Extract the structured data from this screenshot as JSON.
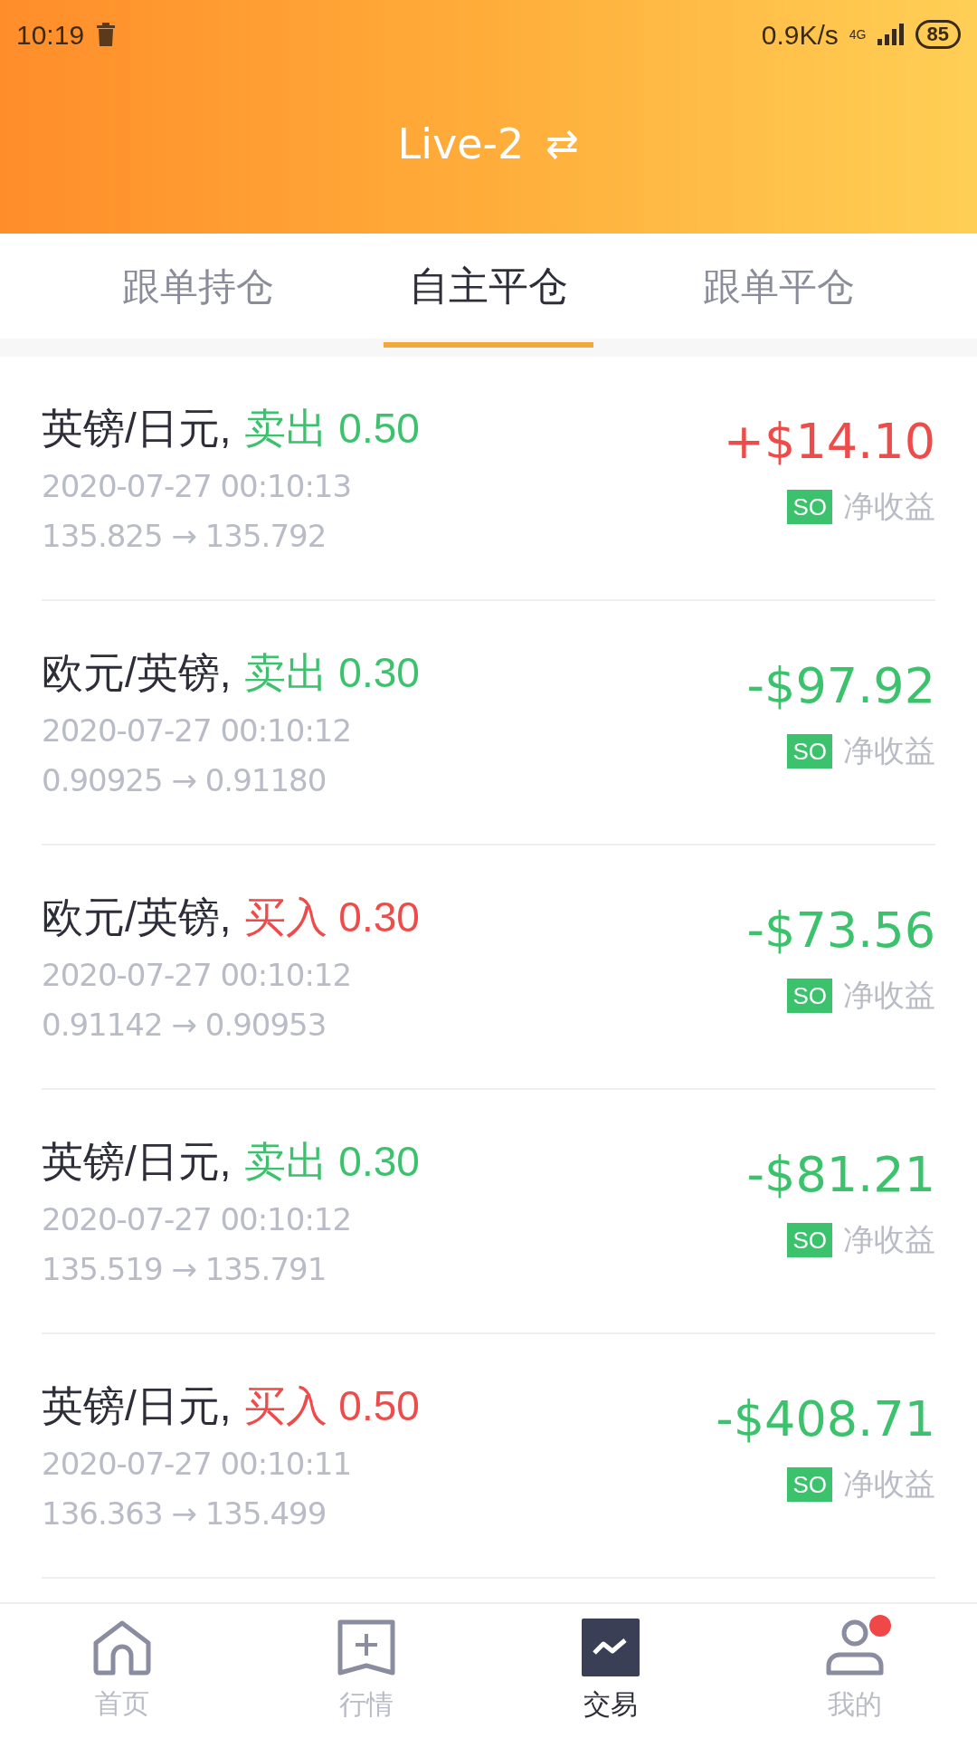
{
  "status_bar": {
    "time": "10:19",
    "speed": "0.9K/s",
    "network": "4G",
    "battery": "85"
  },
  "header": {
    "title": "Live-2",
    "switch_icon": "⇄"
  },
  "tabs": [
    {
      "label": "跟单持仓",
      "selected": false
    },
    {
      "label": "自主平仓",
      "selected": true
    },
    {
      "label": "跟单平仓",
      "selected": false
    }
  ],
  "trades": [
    {
      "pair": "英镑/日元,",
      "side": {
        "text": "卖出 0.50",
        "color": "#3cc26c"
      },
      "time": "2020-07-27 00:10:13",
      "prices": "135.825 → 135.792",
      "amount": {
        "text": "+$14.10",
        "color": "#ee4b4b"
      },
      "tag": "SO",
      "note": "净收益"
    },
    {
      "pair": "欧元/英镑,",
      "side": {
        "text": "卖出 0.30",
        "color": "#3cc26c"
      },
      "time": "2020-07-27 00:10:12",
      "prices": "0.90925 → 0.91180",
      "amount": {
        "text": "-$97.92",
        "color": "#3cc26c"
      },
      "tag": "SO",
      "note": "净收益"
    },
    {
      "pair": "欧元/英镑,",
      "side": {
        "text": "买入 0.30",
        "color": "#ee4b4b"
      },
      "time": "2020-07-27 00:10:12",
      "prices": "0.91142 → 0.90953",
      "amount": {
        "text": "-$73.56",
        "color": "#3cc26c"
      },
      "tag": "SO",
      "note": "净收益"
    },
    {
      "pair": "英镑/日元,",
      "side": {
        "text": "卖出 0.30",
        "color": "#3cc26c"
      },
      "time": "2020-07-27 00:10:12",
      "prices": "135.519 → 135.791",
      "amount": {
        "text": "-$81.21",
        "color": "#3cc26c"
      },
      "tag": "SO",
      "note": "净收益"
    },
    {
      "pair": "英镑/日元,",
      "side": {
        "text": "买入 0.50",
        "color": "#ee4b4b"
      },
      "time": "2020-07-27 00:10:11",
      "prices": "136.363 → 135.499",
      "amount": {
        "text": "-$408.71",
        "color": "#3cc26c"
      },
      "tag": "SO",
      "note": "净收益"
    }
  ],
  "bottom_nav": [
    {
      "label": "首页",
      "kind": "home",
      "selected": false,
      "badge": false
    },
    {
      "label": "行情",
      "kind": "market",
      "selected": false,
      "badge": false
    },
    {
      "label": "交易",
      "kind": "trade",
      "selected": true,
      "badge": false
    },
    {
      "label": "我的",
      "kind": "profile",
      "selected": false,
      "badge": true
    }
  ]
}
